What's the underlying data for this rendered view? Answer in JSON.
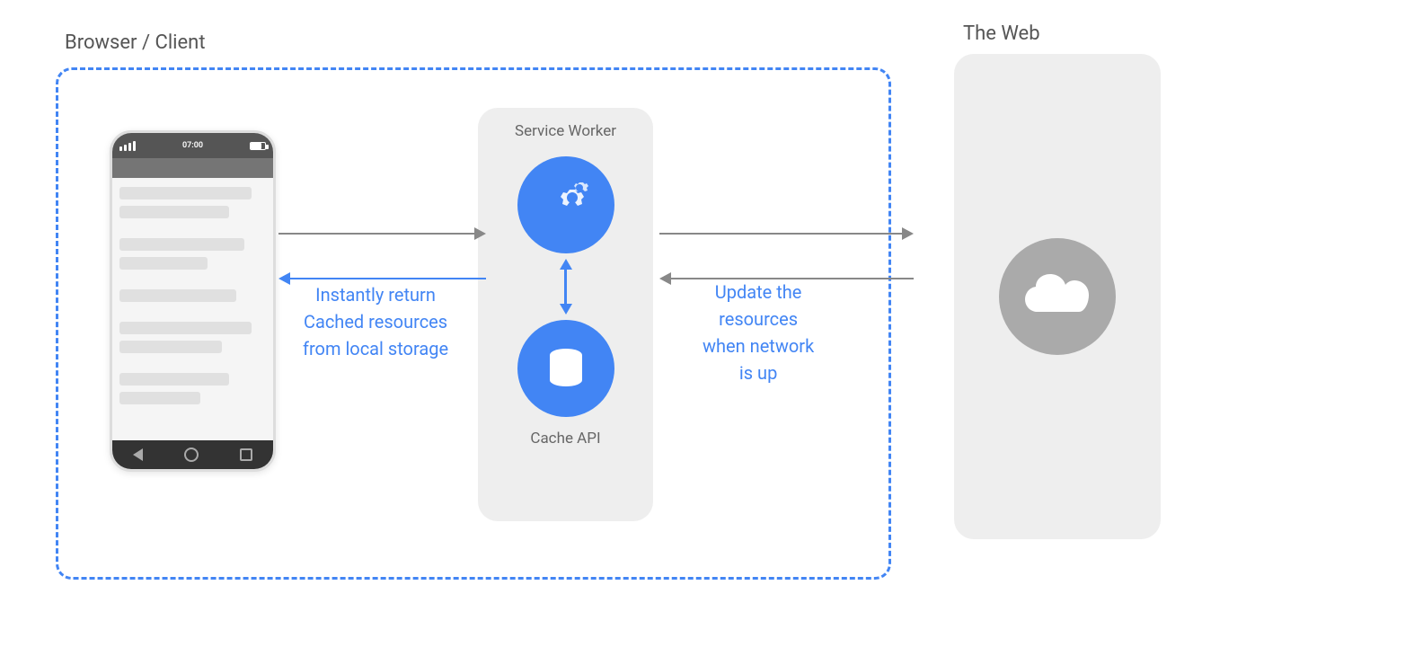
{
  "diagram": {
    "browser_label": "Browser / Client",
    "web_label": "The Web",
    "sw_label": "Service Worker",
    "cache_label": "Cache API",
    "instantly_return_line1": "Instantly return",
    "instantly_return_line2": "Cached resources",
    "instantly_return_line3": "from local storage",
    "update_line1": "Update the",
    "update_line2": "resources",
    "update_line3": "when network",
    "update_line4": "is up",
    "colors": {
      "blue": "#4285F4",
      "gray_arrow": "#888888",
      "light_gray_bg": "#f0f0f0",
      "med_gray": "#aaaaaa"
    }
  }
}
